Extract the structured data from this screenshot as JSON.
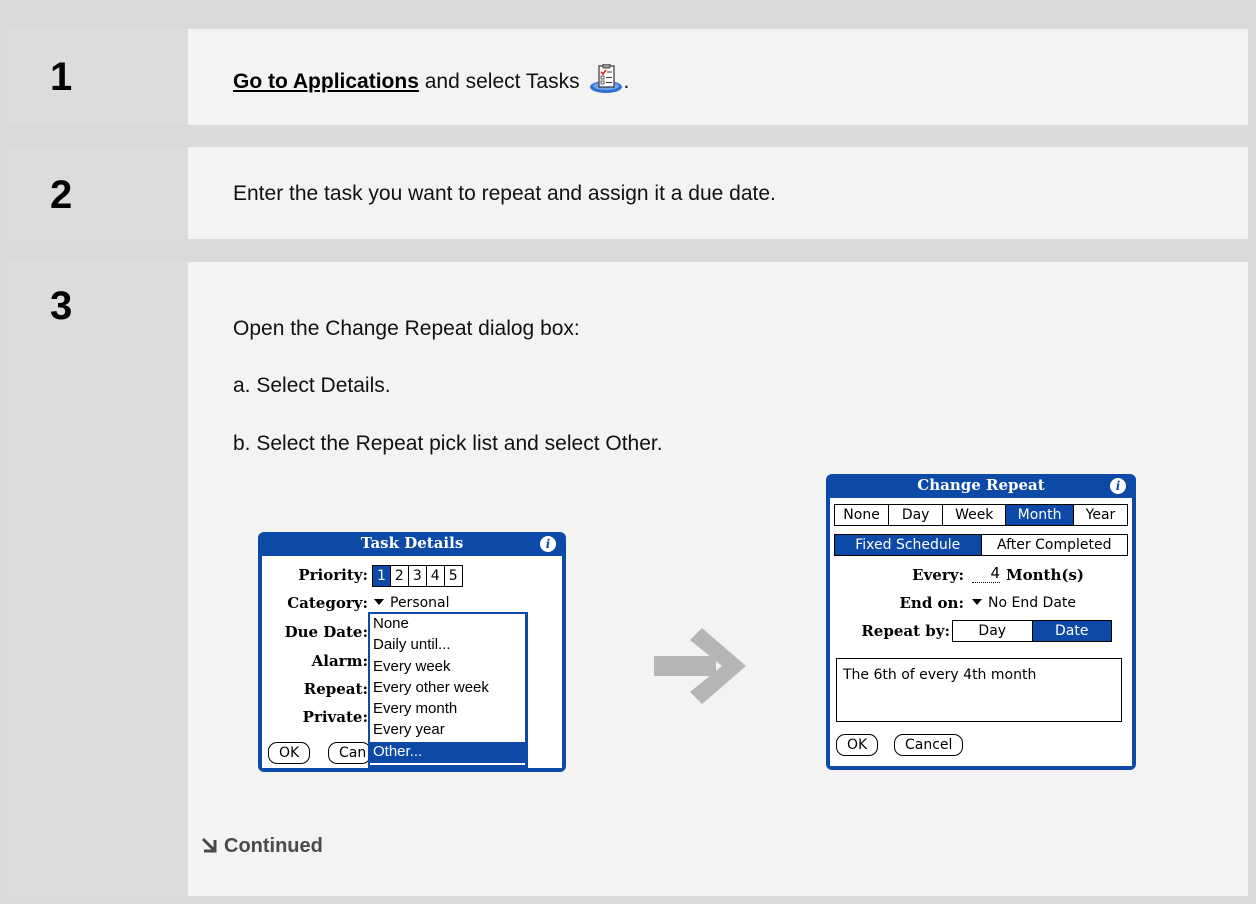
{
  "steps": [
    {
      "number": "1",
      "link_text": "Go to Applications",
      "text_after_link": " and select Tasks",
      "text_end": "."
    },
    {
      "number": "2",
      "text": "Enter the task you want to repeat and assign it a due date."
    },
    {
      "number": "3",
      "intro": "Open the Change Repeat dialog box:",
      "sub_a": "a.  Select Details.",
      "sub_b": "b.  Select the Repeat pick list and select Other."
    }
  ],
  "task_details": {
    "title": "Task Details",
    "priority_label": "Priority:",
    "priority_options": [
      "1",
      "2",
      "3",
      "4",
      "5"
    ],
    "priority_selected": "1",
    "category_label": "Category:",
    "category_value": "Personal",
    "due_date_label": "Due Date:",
    "alarm_label": "Alarm:",
    "repeat_label": "Repeat:",
    "private_label": "Private:",
    "ok_label": "OK",
    "cancel_label_partial": "Can",
    "repeat_list": [
      "None",
      "Daily until...",
      "Every week",
      "Every other week",
      "Every month",
      "Every year",
      "Other..."
    ],
    "repeat_selected": "Other..."
  },
  "change_repeat": {
    "title": "Change Repeat",
    "period_tabs": [
      "None",
      "Day",
      "Week",
      "Month",
      "Year"
    ],
    "period_selected": "Month",
    "schedule_tabs": [
      "Fixed Schedule",
      "After Completed"
    ],
    "schedule_selected": "Fixed Schedule",
    "every_label": "Every:",
    "every_value": "4",
    "every_unit": "Month(s)",
    "end_on_label": "End on:",
    "end_on_value": "No End Date",
    "repeat_by_label": "Repeat by:",
    "repeat_by_options": [
      "Day",
      "Date"
    ],
    "repeat_by_selected": "Date",
    "description": "The 6th of every 4th month",
    "ok_label": "OK",
    "cancel_label": "Cancel"
  },
  "continued_label": "Continued",
  "colors": {
    "palm_blue": "#0d4aa8",
    "number_column": "#dcdcdc",
    "body_background": "#f3f3f3",
    "arrow_gray": "#b5b5b5"
  }
}
